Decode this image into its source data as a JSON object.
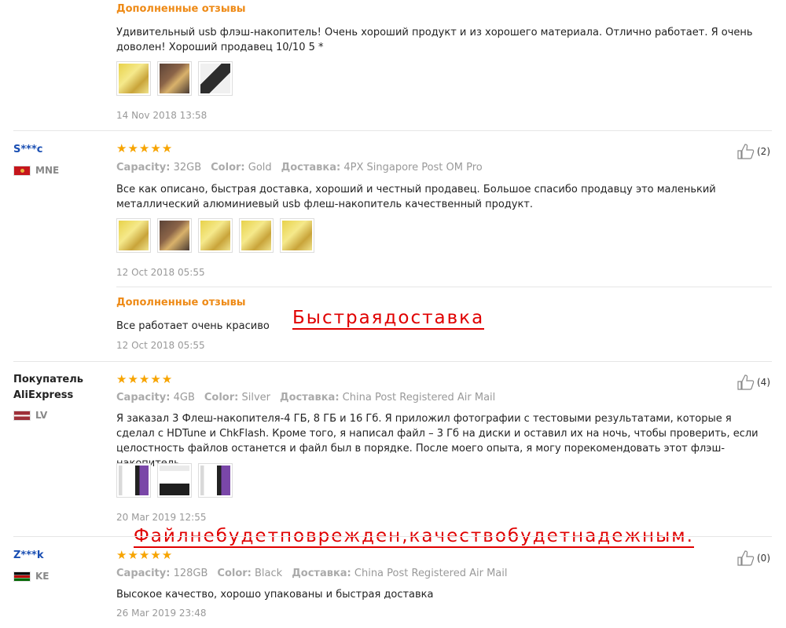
{
  "followup_label": "Дополненные отзывы",
  "top_followup": {
    "text": "Удивительный usb флэш-накопитель! Очень хороший продукт и из хорошего материала. Отлично работает. Я очень доволен! Хороший продавец 10/10 5 *",
    "date": "14 Nov 2018 13:58"
  },
  "attr_labels": {
    "capacity": "Capacity:",
    "color": "Color:",
    "delivery": "Доставка:"
  },
  "stars": "★★★★★",
  "reviews": [
    {
      "user": "S***c",
      "country": "MNE",
      "capacity": "32GB",
      "color": "Gold",
      "delivery": "4PX Singapore Post OM Pro",
      "likes": "(2)",
      "text": "Все как описано, быстрая доставка, хороший и честный продавец. Большое спасибо продавцу это маленький металлический алюминиевый usb флеш-накопитель качественный продукт.",
      "date": "12 Oct 2018 05:55",
      "followup_text": "Все работает очень красиво",
      "followup_date": "12 Oct 2018 05:55"
    },
    {
      "user": "Покупатель AliExpress",
      "country": "LV",
      "capacity": "4GB",
      "color": "Silver",
      "delivery": "China Post Registered Air Mail",
      "likes": "(4)",
      "text": "Я заказал 3 Флеш-накопителя-4 ГБ, 8 ГБ и 16 Гб. Я приложил фотографии с тестовыми результатами, которые я сделал с HDTune и ChkFlash. Кроме того, я написал файл – 3 Гб на диски и оставил их на ночь, чтобы проверить, если целостность файлов останется и файл был в порядке. После моего опыта, я могу порекомендовать этот флэш-накопитель.",
      "date": "20 Mar 2019 12:55"
    },
    {
      "user": "Z***k",
      "country": "KE",
      "capacity": "128GB",
      "color": "Black",
      "delivery": "China Post Registered Air Mail",
      "likes": "(0)",
      "text": "Высокое качество, хорошо упакованы и быстрая доставка",
      "date": "26 Mar 2019 23:48"
    }
  ],
  "overlays": {
    "fast_delivery": "Быстраядоставка",
    "file_ok": "Файлнебудетповрежден,качествобудетнадежным."
  },
  "colors": {
    "accent_orange": "#ee8a16",
    "username_blue": "#1a4fb3",
    "star": "#f7a400",
    "overlay_red": "#e00000"
  }
}
